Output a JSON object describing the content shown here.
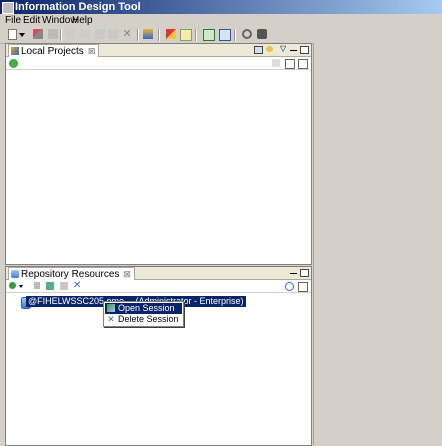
{
  "window": {
    "title": "Information Design Tool"
  },
  "menu": [
    "File",
    "Edit",
    "Window",
    "Help"
  ],
  "toolbar": {
    "icons": [
      "new-icon",
      "new-dropdown-icon",
      "tools-icon",
      "save-icon",
      "save-all-icon",
      "cut-icon",
      "copy-icon",
      "paste-icon",
      "delete-icon",
      "publish-icon",
      "check-integrity-icon",
      "show-values-icon",
      "switch-layout-icon",
      "perspective-icon",
      "connect-icon",
      "find-icon"
    ]
  },
  "local_projects": {
    "tab_label": "Local Projects"
  },
  "repository_resources": {
    "tab_label": "Repository Resources",
    "session_label": "@FIHELWSSC205.eme… (Administrator - Enterprise)",
    "context_menu": [
      "Open Session",
      "Delete Session"
    ]
  },
  "colors": {
    "selection": "#0a246a",
    "chrome": "#d4d0c8",
    "title_start": "#0a246a",
    "title_end": "#a6caf0"
  }
}
